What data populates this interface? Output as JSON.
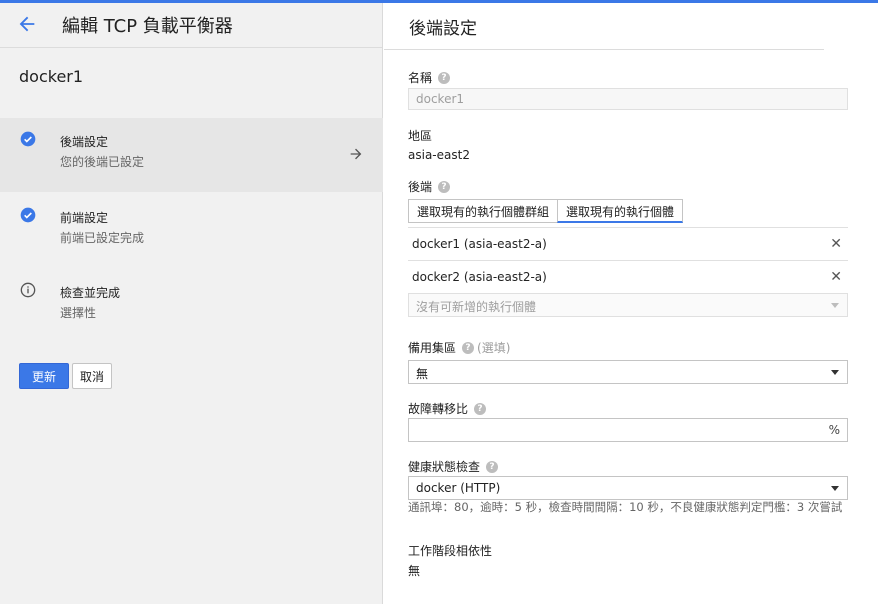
{
  "left": {
    "title": "編輯 TCP 負載平衡器",
    "lb_name": "docker1",
    "steps": [
      {
        "title": "後端設定",
        "subtitle": "您的後端已設定",
        "status": "done"
      },
      {
        "title": "前端設定",
        "subtitle": "前端已設定完成",
        "status": "done"
      },
      {
        "title": "檢查並完成",
        "subtitle": "選擇性",
        "status": "info"
      }
    ],
    "update_button": "更新",
    "cancel_button": "取消"
  },
  "right": {
    "title": "後端設定",
    "name": {
      "label": "名稱",
      "value": "docker1"
    },
    "region": {
      "label": "地區",
      "value": "asia-east2"
    },
    "backend": {
      "label": "後端",
      "tabs": [
        "選取現有的執行個體群組",
        "選取現有的執行個體"
      ],
      "selected_tab": 1,
      "instances": [
        "docker1 (asia-east2-a)",
        "docker2 (asia-east2-a)"
      ],
      "add_placeholder": "沒有可新增的執行個體"
    },
    "backup_pool": {
      "label": "備用集區",
      "optional": "(選填)",
      "value": "無"
    },
    "failover_ratio": {
      "label": "故障轉移比",
      "value": "",
      "unit": "%"
    },
    "health_check": {
      "label": "健康狀態檢查",
      "value": "docker (HTTP)",
      "description": "通訊埠：80，逾時：5 秒，檢查時間間隔：10 秒，不良健康狀態判定門檻：3 次嘗試"
    },
    "session_affinity": {
      "label": "工作階段相依性",
      "value": "無"
    }
  },
  "colors": {
    "accent": "#3b78e7",
    "check": "#3b78e7"
  },
  "icons": {
    "back": "arrow-left-icon",
    "done": "check-circle-icon",
    "info": "info-icon",
    "go": "arrow-right-icon",
    "remove": "close-icon",
    "help": "help-icon",
    "dropdown": "caret-down-icon"
  }
}
